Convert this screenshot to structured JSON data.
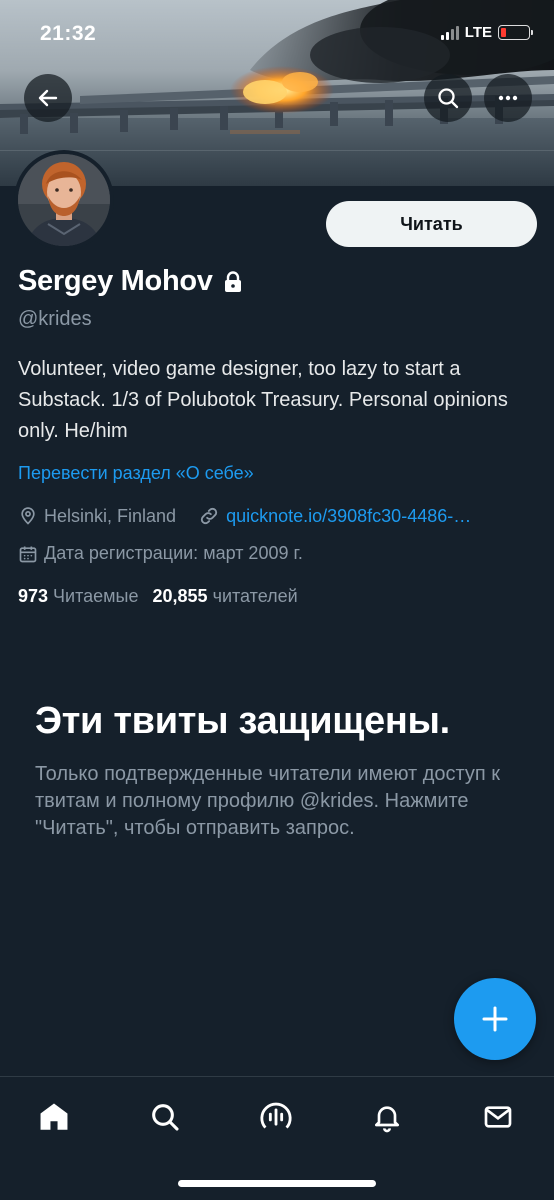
{
  "status_bar": {
    "time": "21:32",
    "network": "LTE"
  },
  "header": {
    "back_icon": "arrow-left-icon",
    "search_icon": "search-icon",
    "more_icon": "more-horizontal-icon"
  },
  "profile": {
    "follow_label": "Читать",
    "name": "Sergey Mohov",
    "handle": "@krides",
    "bio": "Volunteer, video game designer, too lazy to start a Substack. 1/3 of Polubotok Treasury. Personal opinions only. He/him",
    "translate_label": "Перевести раздел «О себе»",
    "location": "Helsinki, Finland",
    "link": "quicknote.io/3908fc30-4486-…",
    "joined": "Дата регистрации: март 2009 г.",
    "following_count": "973",
    "following_label": "Читаемые",
    "followers_count": "20,855",
    "followers_label": "читателей"
  },
  "protected": {
    "title": "Эти твиты защищены.",
    "text": "Только подтвержденные читатели имеют доступ к твитам и полному профилю @krides. Нажмите \"Читать\", чтобы отправить запрос."
  },
  "fab": {
    "icon": "plus-icon"
  },
  "bottom_nav": {
    "items": [
      {
        "icon": "home-icon",
        "active": true
      },
      {
        "icon": "search-icon",
        "active": false
      },
      {
        "icon": "spaces-icon",
        "active": false
      },
      {
        "icon": "bell-icon",
        "active": false
      },
      {
        "icon": "mail-icon",
        "active": false
      }
    ]
  },
  "colors": {
    "background": "#15202b",
    "accent": "#1d9bf0",
    "secondary_text": "#8b98a5",
    "primary_text": "#e7e9ea"
  }
}
